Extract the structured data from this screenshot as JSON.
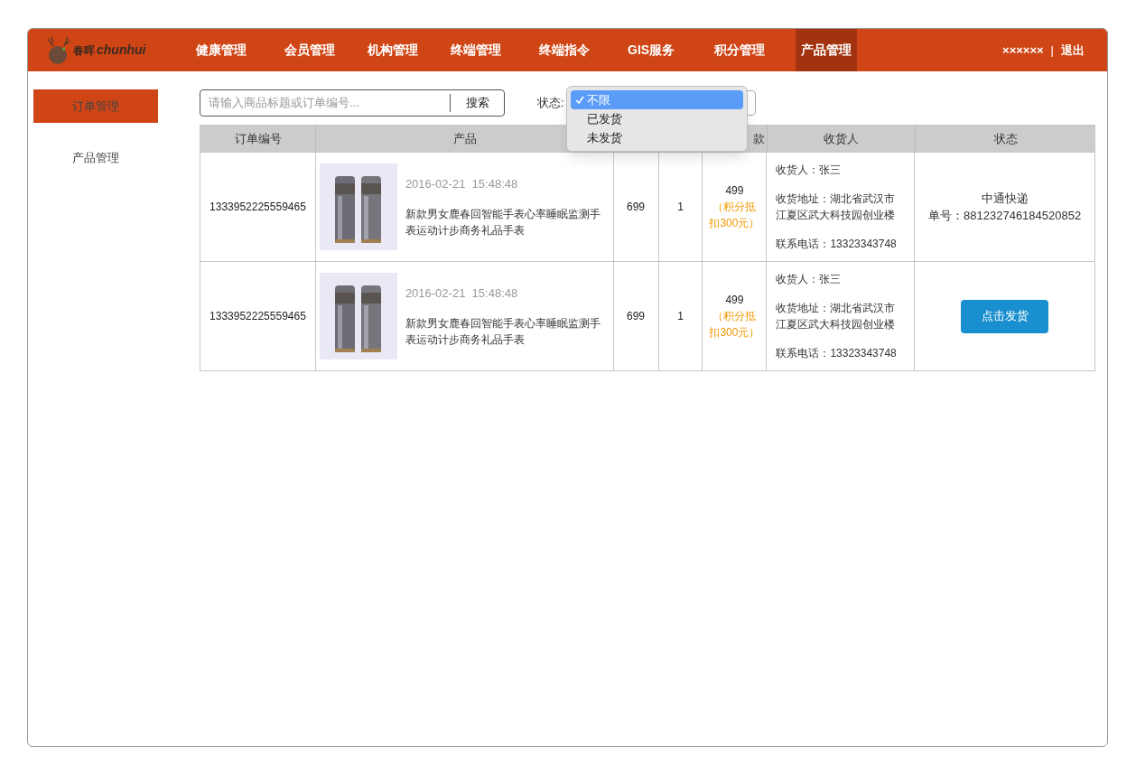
{
  "brand": {
    "name_cn": "春晖",
    "name_en": "chunhui"
  },
  "nav": [
    {
      "label": "健康管理",
      "selected": false
    },
    {
      "label": "会员管理",
      "selected": false
    },
    {
      "label": "机构管理",
      "selected": false
    },
    {
      "label": "终端管理",
      "selected": false
    },
    {
      "label": "终端指令",
      "selected": false
    },
    {
      "label": "GIS服务",
      "selected": false
    },
    {
      "label": "积分管理",
      "selected": false
    },
    {
      "label": "产品管理",
      "selected": true
    }
  ],
  "user": {
    "name": "××××××",
    "separator": "|",
    "logout": "退出"
  },
  "sidebar": {
    "items": [
      {
        "label": "订单管理",
        "selected": true
      },
      {
        "label": "产品管理",
        "selected": false
      }
    ]
  },
  "search": {
    "placeholder": "请输入商品标题或订单编号...",
    "button": "搜索"
  },
  "status_filter": {
    "label": "状态:",
    "options": [
      {
        "label": "不限",
        "selected": true
      },
      {
        "label": "已发货",
        "selected": false
      },
      {
        "label": "未发货",
        "selected": false
      }
    ]
  },
  "table": {
    "columns": [
      "订单编号",
      "产品",
      null,
      null,
      "款",
      "收货人",
      "状态"
    ],
    "rows": [
      {
        "order_no": "1333952225559465",
        "time": "2016-02-21  15:48:48",
        "title": "新款男女鹿春回智能手表心率睡眠监测手表运动计步商务礼品手表",
        "price": "699",
        "qty": "1",
        "paid": "499",
        "discount": "（积分抵扣300元）",
        "receiver": "收货人：张三",
        "address": "收货地址：湖北省武汉市江夏区武大科技园创业楼",
        "phone": "联系电话：13323343748",
        "status": {
          "kind": "shipped",
          "carrier": "中通快递",
          "tracking": "单号：881232746184520852"
        }
      },
      {
        "order_no": "1333952225559465",
        "time": "2016-02-21  15:48:48",
        "title": "新款男女鹿春回智能手表心率睡眠监测手表运动计步商务礼品手表",
        "price": "699",
        "qty": "1",
        "paid": "499",
        "discount": "（积分抵扣300元）",
        "receiver": "收货人：张三",
        "address": "收货地址：湖北省武汉市江夏区武大科技园创业楼",
        "phone": "联系电话：13323343748",
        "status": {
          "kind": "pending",
          "button": "点击发货"
        }
      }
    ]
  }
}
